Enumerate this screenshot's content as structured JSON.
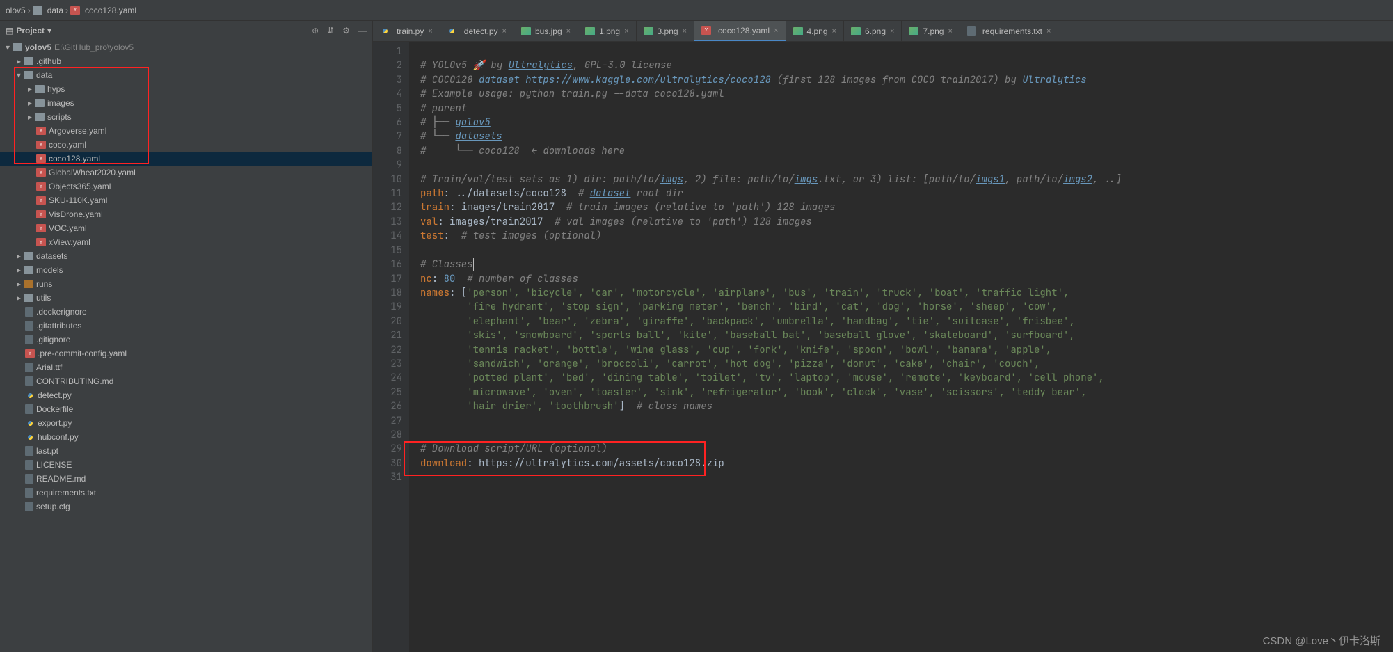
{
  "breadcrumbs": {
    "root": "olov5",
    "data": "data",
    "file": "coco128.yaml"
  },
  "projectLabel": "Project",
  "tree": {
    "root": {
      "name": "yolov5",
      "path": "E:\\GitHub_pro\\yolov5"
    },
    "github": ".github",
    "data": "data",
    "hyps": "hyps",
    "images": "images",
    "scripts": "scripts",
    "argoverse": "Argoverse.yaml",
    "coco": "coco.yaml",
    "coco128": "coco128.yaml",
    "globalwheat": "GlobalWheat2020.yaml",
    "objects365": "Objects365.yaml",
    "sku": "SKU-110K.yaml",
    "visdrone": "VisDrone.yaml",
    "voc": "VOC.yaml",
    "xview": "xView.yaml",
    "datasets": "datasets",
    "models": "models",
    "runs": "runs",
    "utils": "utils",
    "dockerignore": ".dockerignore",
    "gitattributes": ".gitattributes",
    "gitignore": ".gitignore",
    "precommit": ".pre-commit-config.yaml",
    "arial": "Arial.ttf",
    "contributing": "CONTRIBUTING.md",
    "detect": "detect.py",
    "dockerfile": "Dockerfile",
    "export": "export.py",
    "hubconf": "hubconf.py",
    "lastpt": "last.pt",
    "license": "LICENSE",
    "readme": "README.md",
    "requirements": "requirements.txt",
    "setup": "setup.cfg"
  },
  "tabs": {
    "train": "train.py",
    "detect": "detect.py",
    "bus": "bus.jpg",
    "p1": "1.png",
    "p3": "3.png",
    "coco128": "coco128.yaml",
    "p4": "4.png",
    "p6": "6.png",
    "p7": "7.png",
    "req": "requirements.txt"
  },
  "code": {
    "l1a": "# YOLOv5 🚀 by ",
    "l1b": "Ultralytics",
    "l1c": ", GPL-3.0 license",
    "l2a": "# COCO128 ",
    "l2b": "dataset",
    "l2sp": " ",
    "l2c": "https://www.kaggle.com/ultralytics/coco128",
    "l2d": " (first 128 images from COCO train2017) by ",
    "l2e": "Ultralytics",
    "l3": "# Example usage: python train.py --data coco128.yaml",
    "l4": "# parent",
    "l5a": "# ├── ",
    "l5b": "yolov5",
    "l6a": "# └── ",
    "l6b": "datasets",
    "l7": "#     └── coco128  ← downloads here",
    "l9a": "# Train/val/test sets as 1) dir: path/to/",
    "l9b": "imgs",
    "l9c": ", 2) file: path/to/",
    "l9d": "imgs",
    "l9e": ".txt, or 3) list: [path/to/",
    "l9f": "imgs1",
    "l9g": ", path/to/",
    "l9h": "imgs2",
    "l9i": ", ..]",
    "l10a": "path",
    "l10b": ": ../datasets/coco128  ",
    "l10c": "# ",
    "l10d": "dataset",
    "l10e": " root dir",
    "l11a": "train",
    "l11b": ": images/train2017  ",
    "l11c": "# train images (relative to 'path') 128 images",
    "l12a": "val",
    "l12b": ": images/train2017  ",
    "l12c": "# val images (relative to 'path') 128 images",
    "l13a": "test",
    "l13b": ":  ",
    "l13c": "# test images (optional)",
    "l16": "# Classes",
    "l17a": "nc",
    "l17b": ": ",
    "l17c": "80",
    "l17d": "  ",
    "l17e": "# number of classes",
    "l18a": "names",
    "l18b": ": [",
    "l18c": "'person', 'bicycle', 'car', 'motorcycle', 'airplane', 'bus', 'train', 'truck', 'boat', 'traffic light',",
    "l19": "        'fire hydrant', 'stop sign', 'parking meter', 'bench', 'bird', 'cat', 'dog', 'horse', 'sheep', 'cow',",
    "l20": "        'elephant', 'bear', 'zebra', 'giraffe', 'backpack', 'umbrella', 'handbag', 'tie', 'suitcase', 'frisbee',",
    "l21": "        'skis', 'snowboard', 'sports ball', 'kite', 'baseball bat', 'baseball glove', 'skateboard', 'surfboard',",
    "l22": "        'tennis racket', 'bottle', 'wine glass', 'cup', 'fork', 'knife', 'spoon', 'bowl', 'banana', 'apple',",
    "l23": "        'sandwich', 'orange', 'broccoli', 'carrot', 'hot dog', 'pizza', 'donut', 'cake', 'chair', 'couch',",
    "l24": "        'potted plant', 'bed', 'dining table', 'toilet', 'tv', 'laptop', 'mouse', 'remote', 'keyboard', 'cell phone',",
    "l25": "        'microwave', 'oven', 'toaster', 'sink', 'refrigerator', 'book', 'clock', 'vase', 'scissors', 'teddy bear',",
    "l26a": "        'hair drier', 'toothbrush'",
    "l26b": "]  ",
    "l26c": "# class names",
    "l29": "# Download script/URL (optional)",
    "l30a": "download",
    "l30b": ": https://ultralytics.com/assets/coco128.zip"
  },
  "lineNums": [
    "1",
    "2",
    "3",
    "4",
    "5",
    "6",
    "7",
    "8",
    "9",
    "10",
    "11",
    "12",
    "13",
    "14",
    "15",
    "16",
    "17",
    "18",
    "19",
    "20",
    "21",
    "22",
    "23",
    "24",
    "25",
    "26",
    "27",
    "28",
    "29",
    "30",
    "31"
  ],
  "watermark": "CSDN @Love丶伊卡洛斯"
}
